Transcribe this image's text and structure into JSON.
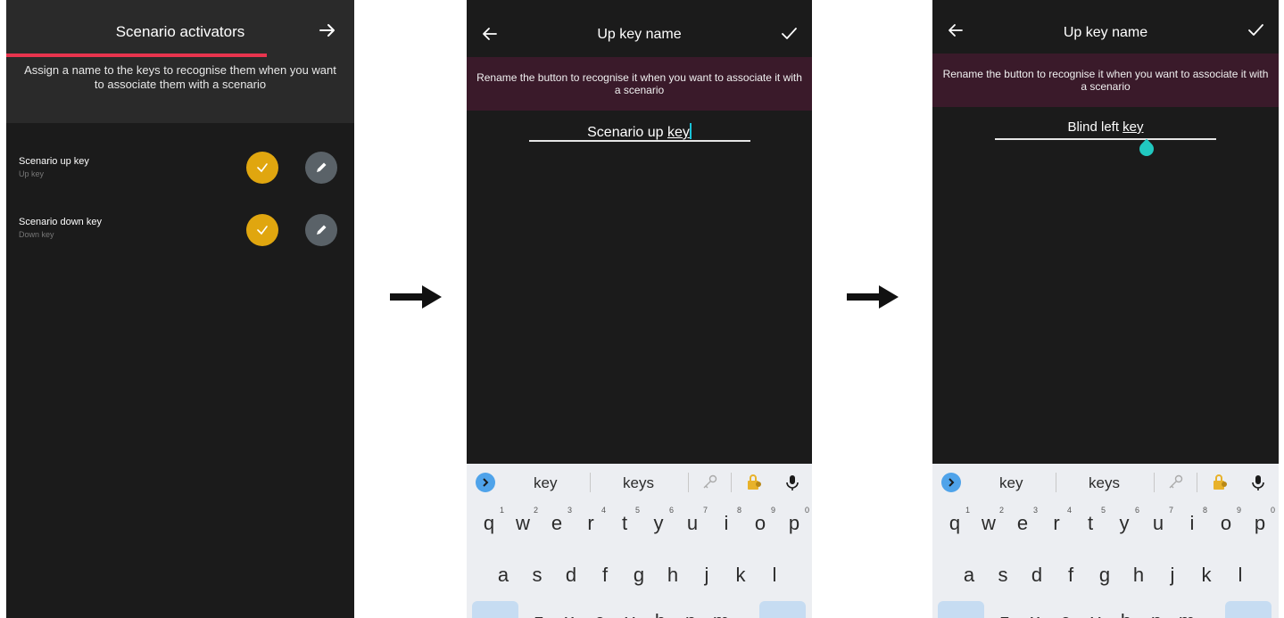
{
  "screen1": {
    "title": "Scenario activators",
    "next_icon": "arrow-right-icon",
    "description": "Assign a name to the keys to recognise them when you want to associate them with a scenario",
    "items": [
      {
        "title": "Scenario up key",
        "subtitle": "Up key"
      },
      {
        "title": "Scenario down key",
        "subtitle": "Down key"
      }
    ],
    "colors": {
      "accent": "#e8344e",
      "confirm": "#e0a60f",
      "edit": "#5a6268"
    }
  },
  "screen2": {
    "title": "Up key name",
    "banner": "Rename the button to recognise it when you want to associate it with a scenario",
    "field_prefix": "Scenario up ",
    "field_suffix": "key",
    "suggestions": [
      "key",
      "keys"
    ]
  },
  "screen3": {
    "title": "Up key name",
    "banner": "Rename the button to recognise it when you want to associate it with a scenario",
    "field_prefix": "Blind left ",
    "field_suffix": "key",
    "suggestions": [
      "key",
      "keys"
    ]
  },
  "keyboard": {
    "row1": [
      {
        "k": "q",
        "n": "1"
      },
      {
        "k": "w",
        "n": "2"
      },
      {
        "k": "e",
        "n": "3"
      },
      {
        "k": "r",
        "n": "4"
      },
      {
        "k": "t",
        "n": "5"
      },
      {
        "k": "y",
        "n": "6"
      },
      {
        "k": "u",
        "n": "7"
      },
      {
        "k": "i",
        "n": "8"
      },
      {
        "k": "o",
        "n": "9"
      },
      {
        "k": "p",
        "n": "0"
      }
    ],
    "row2": [
      "a",
      "s",
      "d",
      "f",
      "g",
      "h",
      "j",
      "k",
      "l"
    ],
    "row3": [
      "z",
      "x",
      "c",
      "v",
      "b",
      "n",
      "m"
    ]
  }
}
